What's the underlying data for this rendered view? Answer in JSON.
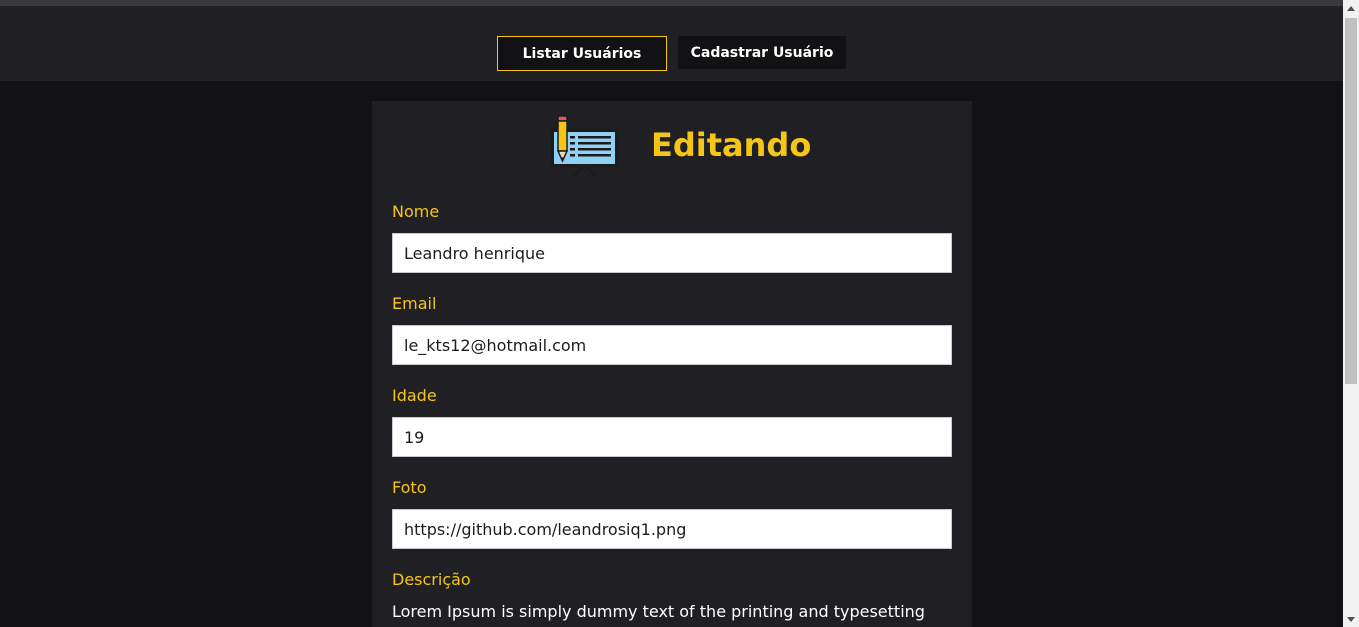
{
  "nav": {
    "list_users_label": "Listar Usuários",
    "create_user_label": "Cadastrar Usuário"
  },
  "form": {
    "title": "Editando",
    "icon": "edit-document-icon",
    "fields": [
      {
        "label": "Nome",
        "value": "Leandro henrique"
      },
      {
        "label": "Email",
        "value": "le_kts12@hotmail.com"
      },
      {
        "label": "Idade",
        "value": "19"
      },
      {
        "label": "Foto",
        "value": "https://github.com/leandrosiq1.png"
      }
    ],
    "description": {
      "label": "Descrição",
      "value": "Lorem Ipsum is simply dummy text of the printing and typesetting"
    }
  },
  "colors": {
    "accent": "#f5c518",
    "background": "#121214",
    "surface": "#202024"
  }
}
